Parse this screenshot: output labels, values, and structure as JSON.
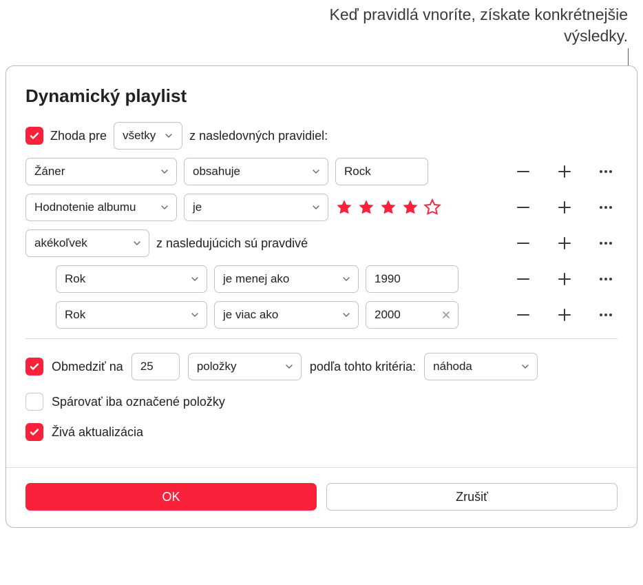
{
  "annotation": "Keď pravidlá vnoríte, získate konkrétnejšie výsledky.",
  "dialog": {
    "title": "Dynamický playlist",
    "match": {
      "checked": true,
      "prefix": "Zhoda pre",
      "mode": "všetky",
      "suffix": "z nasledovných pravidiel:"
    },
    "rules": [
      {
        "field": "Žáner",
        "op": "obsahuje",
        "value": "Rock",
        "kind": "text"
      },
      {
        "field": "Hodnotenie albumu",
        "op": "je",
        "kind": "stars",
        "stars_filled": 4,
        "stars_total": 5
      },
      {
        "field": "akékoľvek",
        "suffix": "z nasledujúcich sú pravdivé",
        "kind": "group",
        "children": [
          {
            "field": "Rok",
            "op": "je menej ako",
            "value": "1990",
            "kind": "text"
          },
          {
            "field": "Rok",
            "op": "je viac ako",
            "value": "2000",
            "kind": "text",
            "clearable": true
          }
        ]
      }
    ],
    "limit": {
      "checked": true,
      "label": "Obmedziť na",
      "count": "25",
      "unit": "položky",
      "by_label": "podľa tohto kritéria:",
      "by": "náhoda"
    },
    "match_checked_only": {
      "checked": false,
      "label": "Spárovať iba označené položky"
    },
    "live_update": {
      "checked": true,
      "label": "Živá aktualizácia"
    },
    "buttons": {
      "ok": "OK",
      "cancel": "Zrušiť"
    }
  },
  "icons": {
    "minus": "minus-icon",
    "plus": "plus-icon",
    "ellipsis": "ellipsis-icon"
  }
}
